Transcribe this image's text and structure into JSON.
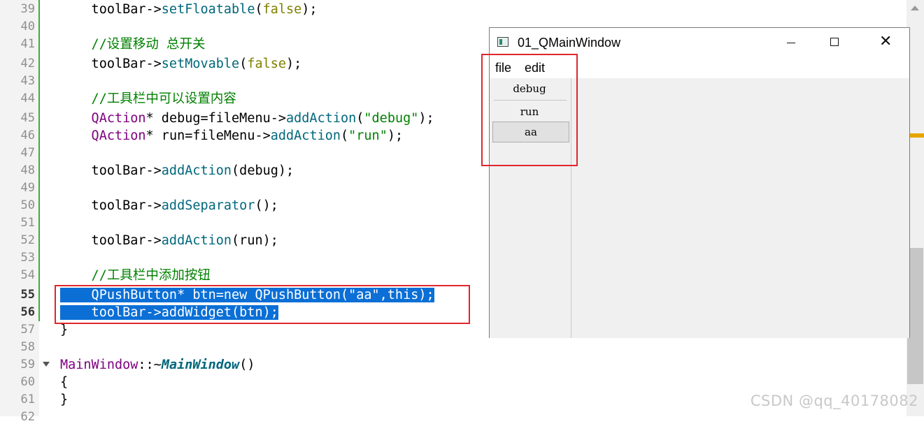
{
  "editor": {
    "lines": [
      {
        "num": "39",
        "parts": [
          {
            "t": "    toolBar->",
            "c": ""
          },
          {
            "t": "setFloatable",
            "c": "c-fn"
          },
          {
            "t": "(",
            "c": ""
          },
          {
            "t": "false",
            "c": "c-kw"
          },
          {
            "t": ");",
            "c": ""
          }
        ]
      },
      {
        "num": "40",
        "parts": []
      },
      {
        "num": "41",
        "parts": [
          {
            "t": "    //设置移动 总开关",
            "c": "c-cmt"
          }
        ]
      },
      {
        "num": "42",
        "parts": [
          {
            "t": "    toolBar->",
            "c": ""
          },
          {
            "t": "setMovable",
            "c": "c-fn"
          },
          {
            "t": "(",
            "c": ""
          },
          {
            "t": "false",
            "c": "c-kw"
          },
          {
            "t": ");",
            "c": ""
          }
        ]
      },
      {
        "num": "43",
        "parts": []
      },
      {
        "num": "44",
        "parts": [
          {
            "t": "    //工具栏中可以设置内容",
            "c": "c-cmt"
          }
        ]
      },
      {
        "num": "45",
        "parts": [
          {
            "t": "    QAction",
            "c": "c-type"
          },
          {
            "t": "* debug=fileMenu->",
            "c": ""
          },
          {
            "t": "addAction",
            "c": "c-fn"
          },
          {
            "t": "(",
            "c": ""
          },
          {
            "t": "\"debug\"",
            "c": "c-str"
          },
          {
            "t": ");",
            "c": ""
          }
        ]
      },
      {
        "num": "46",
        "parts": [
          {
            "t": "    QAction",
            "c": "c-type"
          },
          {
            "t": "* run=fileMenu->",
            "c": ""
          },
          {
            "t": "addAction",
            "c": "c-fn"
          },
          {
            "t": "(",
            "c": ""
          },
          {
            "t": "\"run\"",
            "c": "c-str"
          },
          {
            "t": ");",
            "c": ""
          }
        ]
      },
      {
        "num": "47",
        "parts": []
      },
      {
        "num": "48",
        "parts": [
          {
            "t": "    toolBar->",
            "c": ""
          },
          {
            "t": "addAction",
            "c": "c-fn"
          },
          {
            "t": "(debug);",
            "c": ""
          }
        ]
      },
      {
        "num": "49",
        "parts": []
      },
      {
        "num": "50",
        "parts": [
          {
            "t": "    toolBar->",
            "c": ""
          },
          {
            "t": "addSeparator",
            "c": "c-fn"
          },
          {
            "t": "();",
            "c": ""
          }
        ]
      },
      {
        "num": "51",
        "parts": []
      },
      {
        "num": "52",
        "parts": [
          {
            "t": "    toolBar->",
            "c": ""
          },
          {
            "t": "addAction",
            "c": "c-fn"
          },
          {
            "t": "(run);",
            "c": ""
          }
        ]
      },
      {
        "num": "53",
        "parts": []
      },
      {
        "num": "54",
        "parts": [
          {
            "t": "    //工具栏中添加按钮",
            "c": "c-cmt"
          }
        ]
      },
      {
        "num": "55",
        "bold": true,
        "selected": true,
        "parts": [
          {
            "t": "    QPushButton* btn=new QPushButton(\"aa\",this);",
            "c": "sel-code"
          }
        ]
      },
      {
        "num": "56",
        "bold": true,
        "selected": true,
        "parts": [
          {
            "t": "    toolBar->addWidget(btn);",
            "c": "sel-code"
          }
        ]
      },
      {
        "num": "57",
        "parts": [
          {
            "t": "}",
            "c": ""
          }
        ]
      },
      {
        "num": "58",
        "parts": []
      },
      {
        "num": "59",
        "fold": true,
        "parts": [
          {
            "t": "MainWindow",
            "c": "c-type"
          },
          {
            "t": "::~",
            "c": ""
          },
          {
            "t": "MainWindow",
            "c": "c-bold"
          },
          {
            "t": "()",
            "c": ""
          }
        ]
      },
      {
        "num": "60",
        "parts": [
          {
            "t": "{",
            "c": ""
          }
        ]
      },
      {
        "num": "61",
        "parts": [
          {
            "t": "}",
            "c": ""
          }
        ]
      },
      {
        "num": "62",
        "parts": []
      }
    ]
  },
  "window": {
    "title": "01_QMainWindow",
    "close_glyph": "✕",
    "menu": [
      "file",
      "edit"
    ],
    "toolbar": {
      "debug_label": "debug",
      "run_label": "run",
      "aa_label": "aa"
    }
  },
  "colors": {
    "highlight_box": "#e0262c",
    "selection": "#0b6fd6",
    "scroll_marker": "#e6a600"
  },
  "watermark": "CSDN @qq_40178082"
}
